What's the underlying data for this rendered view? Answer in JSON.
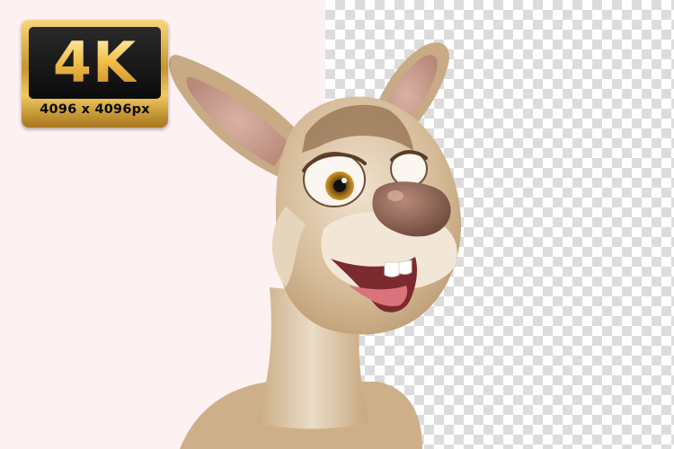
{
  "image": {
    "subject": "cartoon kangaroo character",
    "background_left_color": "#fdf1f1",
    "background_right_pattern": "transparency-checkerboard"
  },
  "badge": {
    "title": "4K",
    "caption": "4096 x 4096px",
    "colors": {
      "frame": "#d9a73a",
      "panel": "#111111",
      "text": "#f2c14e"
    }
  }
}
